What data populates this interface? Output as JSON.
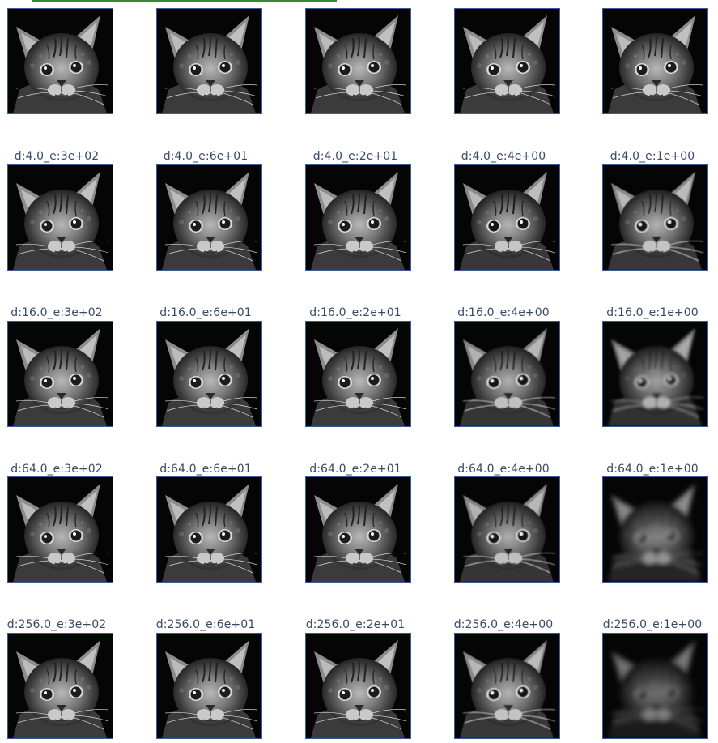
{
  "rows": [
    {
      "cells": [
        {
          "label": "",
          "blur": 0.0,
          "brightness": 1.0
        },
        {
          "label": "",
          "blur": 0.0,
          "brightness": 1.0
        },
        {
          "label": "",
          "blur": 0.0,
          "brightness": 1.0
        },
        {
          "label": "",
          "blur": 0.0,
          "brightness": 1.0
        },
        {
          "label": "",
          "blur": 0.0,
          "brightness": 1.0
        }
      ]
    },
    {
      "cells": [
        {
          "label": "d:4.0_e:3e+02",
          "blur": 0.0,
          "brightness": 1.0
        },
        {
          "label": "d:4.0_e:6e+01",
          "blur": 0.0,
          "brightness": 1.0
        },
        {
          "label": "d:4.0_e:2e+01",
          "blur": 0.0,
          "brightness": 1.0
        },
        {
          "label": "d:4.0_e:4e+00",
          "blur": 0.2,
          "brightness": 0.97
        },
        {
          "label": "d:4.0_e:1e+00",
          "blur": 0.4,
          "brightness": 0.95
        }
      ]
    },
    {
      "cells": [
        {
          "label": "d:16.0_e:3e+02",
          "blur": 0.0,
          "brightness": 1.0
        },
        {
          "label": "d:16.0_e:6e+01",
          "blur": 0.0,
          "brightness": 1.0
        },
        {
          "label": "d:16.0_e:2e+01",
          "blur": 0.2,
          "brightness": 1.0
        },
        {
          "label": "d:16.0_e:4e+00",
          "blur": 0.6,
          "brightness": 0.9
        },
        {
          "label": "d:16.0_e:1e+00",
          "blur": 1.6,
          "brightness": 0.75
        }
      ]
    },
    {
      "cells": [
        {
          "label": "d:64.0_e:3e+02",
          "blur": 0.0,
          "brightness": 1.0
        },
        {
          "label": "d:64.0_e:6e+01",
          "blur": 0.0,
          "brightness": 1.0
        },
        {
          "label": "d:64.0_e:2e+01",
          "blur": 0.2,
          "brightness": 1.0
        },
        {
          "label": "d:64.0_e:4e+00",
          "blur": 0.6,
          "brightness": 0.9
        },
        {
          "label": "d:64.0_e:1e+00",
          "blur": 2.8,
          "brightness": 0.5
        }
      ]
    },
    {
      "cells": [
        {
          "label": "d:256.0_e:3e+02",
          "blur": 0.0,
          "brightness": 1.0
        },
        {
          "label": "d:256.0_e:6e+01",
          "blur": 0.0,
          "brightness": 1.0
        },
        {
          "label": "d:256.0_e:2e+01",
          "blur": 0.0,
          "brightness": 1.0
        },
        {
          "label": "d:256.0_e:4e+00",
          "blur": 0.4,
          "brightness": 0.95
        },
        {
          "label": "d:256.0_e:1e+00",
          "blur": 3.2,
          "brightness": 0.35
        }
      ]
    }
  ],
  "colors": {
    "label": "#3a4a66",
    "border": "#3b5b9a",
    "accent": "#2e8b2e"
  },
  "image_subject": "kitten-photo"
}
